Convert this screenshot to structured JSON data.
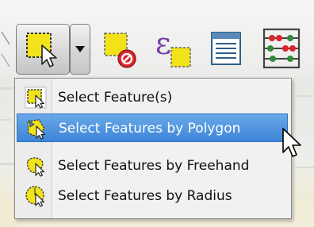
{
  "toolbar": {
    "buttons": [
      {
        "icon": "select-feature-icon",
        "tooltip": ""
      },
      {
        "icon": "dropdown-arrow-icon"
      },
      {
        "icon": "deselect-features-icon"
      },
      {
        "icon": "select-by-expression-icon"
      },
      {
        "icon": "attribute-table-icon"
      },
      {
        "icon": "field-calculator-icon"
      }
    ]
  },
  "menu": {
    "items": [
      {
        "label": "Select Feature(s)",
        "icon": "select-feature-icon",
        "highlighted": false
      },
      {
        "label": "Select Features by Polygon",
        "icon": "select-polygon-icon",
        "highlighted": true
      },
      {
        "label": "Select Features by Freehand",
        "icon": "select-freehand-icon",
        "highlighted": false
      },
      {
        "label": "Select Features by Radius",
        "icon": "select-radius-icon",
        "highlighted": false
      }
    ]
  },
  "colors": {
    "highlight": "#3d86d8",
    "select_yellow": "#f2e21a",
    "deselect_red": "#d9242a",
    "expression_purple": "#7a3da8"
  }
}
